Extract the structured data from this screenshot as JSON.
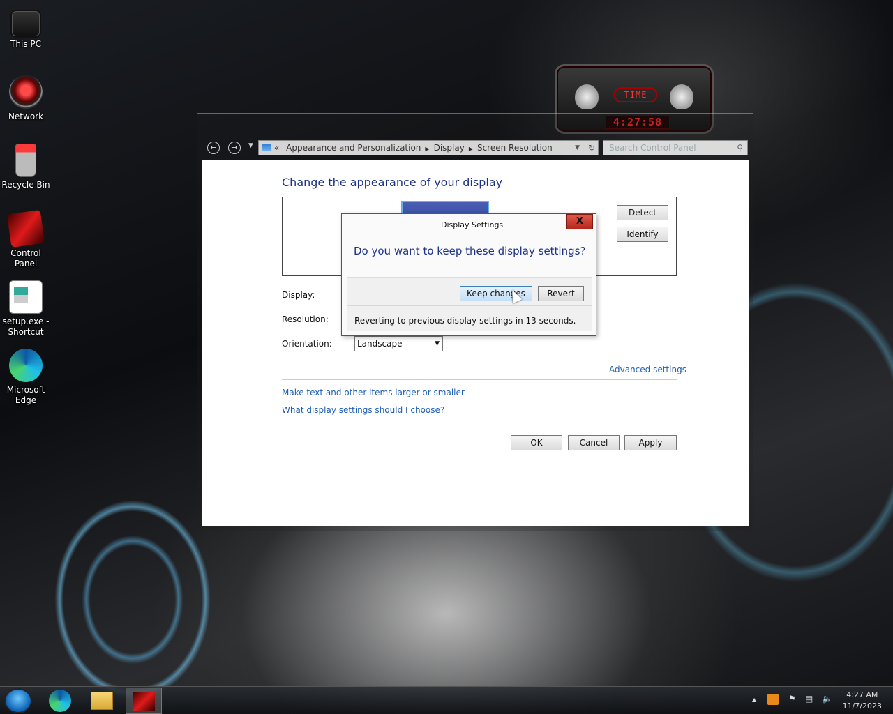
{
  "desktop": {
    "icons": [
      {
        "label": "This PC"
      },
      {
        "label": "Network"
      },
      {
        "label": "Recycle Bin"
      },
      {
        "label": "Control Panel"
      },
      {
        "label": "setup.exe - Shortcut"
      },
      {
        "label": "Microsoft Edge"
      }
    ]
  },
  "gadget": {
    "label": "TIME",
    "time": "4:27:58"
  },
  "window": {
    "breadcrumb": {
      "prefix": "«",
      "items": [
        "Appearance and Personalization",
        "Display",
        "Screen Resolution"
      ]
    },
    "search_placeholder": "Search Control Panel",
    "heading": "Change the appearance of your display",
    "detect_label": "Detect",
    "identify_label": "Identify",
    "display_label": "Display:",
    "resolution_label": "Resolution:",
    "orientation_label": "Orientation:",
    "orientation_value": "Landscape",
    "advanced_link": "Advanced settings",
    "text_size_link": "Make text and other items larger or smaller",
    "help_link": "What display settings should I choose?",
    "ok_label": "OK",
    "cancel_label": "Cancel",
    "apply_label": "Apply"
  },
  "dialog": {
    "title": "Display Settings",
    "close_label": "X",
    "question": "Do you want to keep these display settings?",
    "keep_label": "Keep changes",
    "revert_label": "Revert",
    "message": "Reverting to previous display settings in 13 seconds."
  },
  "taskbar": {
    "time": "4:27 AM",
    "date": "11/7/2023",
    "tray_arrow": "▲"
  }
}
